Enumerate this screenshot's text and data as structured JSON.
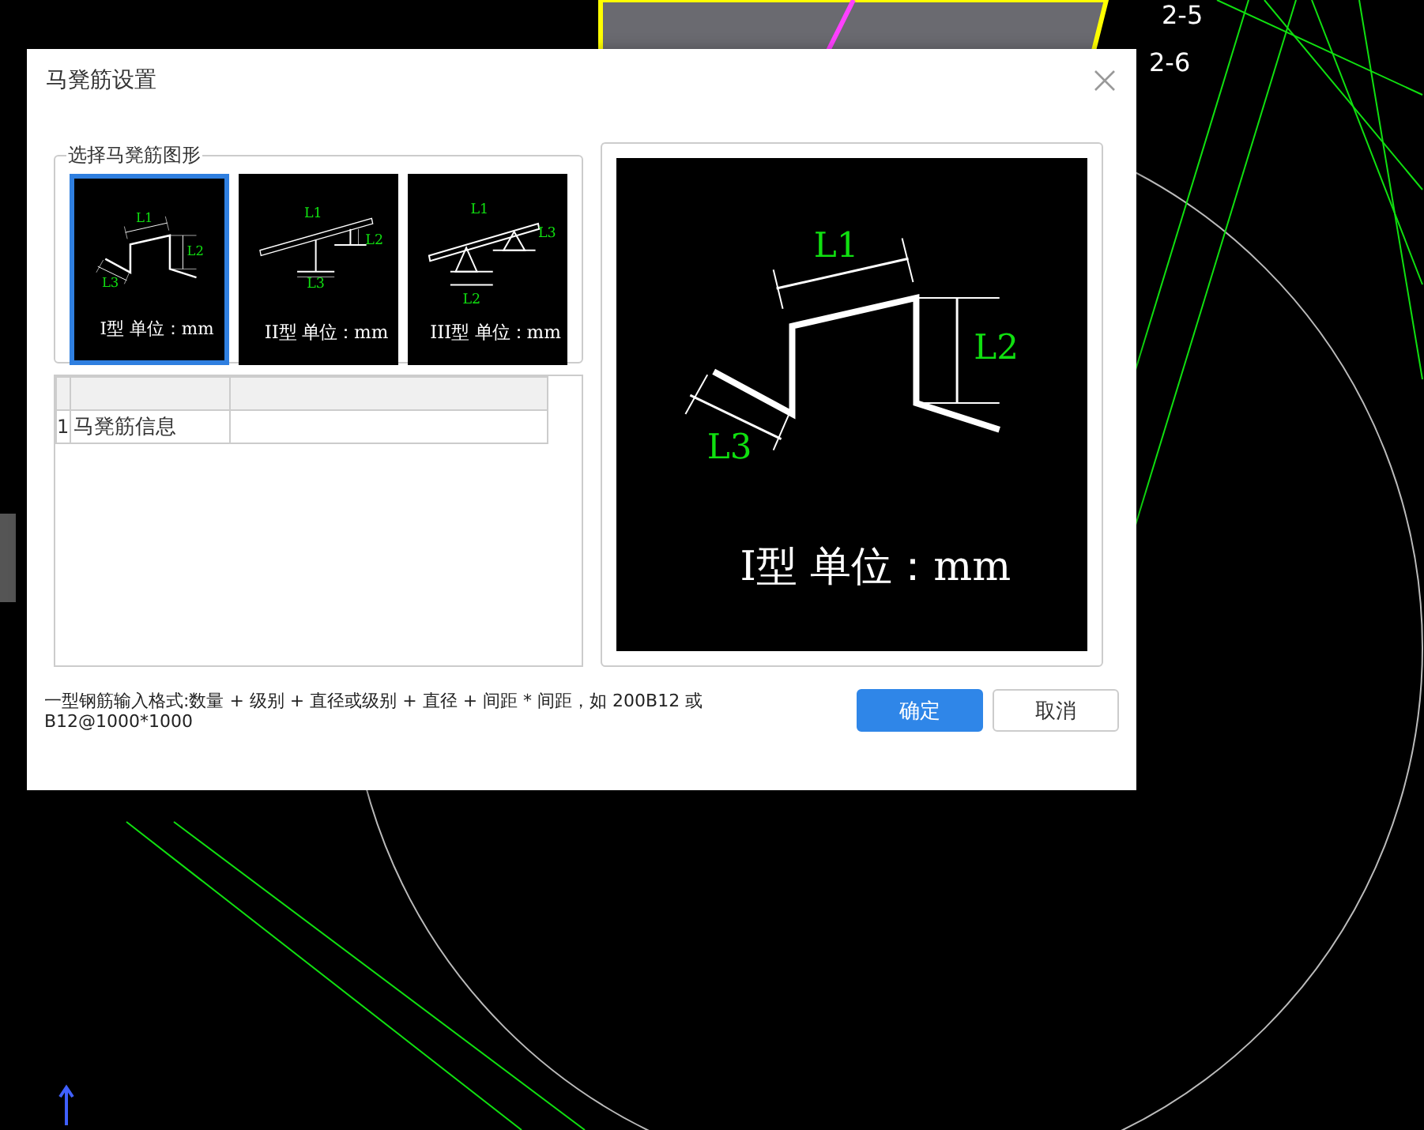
{
  "cad_labels": [
    "2-5",
    "2-6"
  ],
  "dialog": {
    "title": "马凳筋设置",
    "group_title": "选择马凳筋图形",
    "shapes": [
      {
        "kind": "type1",
        "caption": "I型 单位：mm",
        "labels": [
          "L1",
          "L2",
          "L3"
        ],
        "selected": true
      },
      {
        "kind": "type2",
        "caption": "II型 单位：mm",
        "labels": [
          "L1",
          "L2",
          "L3"
        ],
        "selected": false
      },
      {
        "kind": "type3",
        "caption": "III型 单位：mm",
        "labels": [
          "L1",
          "L3",
          "L2"
        ],
        "selected": false
      }
    ],
    "table": {
      "rows": [
        {
          "number": "1",
          "label": "马凳筋信息"
        }
      ]
    },
    "preview": {
      "kind": "type1",
      "caption": "I型 单位：mm",
      "labels": [
        "L1",
        "L2",
        "L3"
      ]
    },
    "hint": "一型钢筋输入格式:数量 + 级别 + 直径或级别 + 直径 + 间距 * 间距，如 200B12 或 B12@1000*1000",
    "buttons": [
      {
        "label": "确定",
        "kind": "primary"
      },
      {
        "label": "取消",
        "kind": "secondary"
      }
    ]
  }
}
